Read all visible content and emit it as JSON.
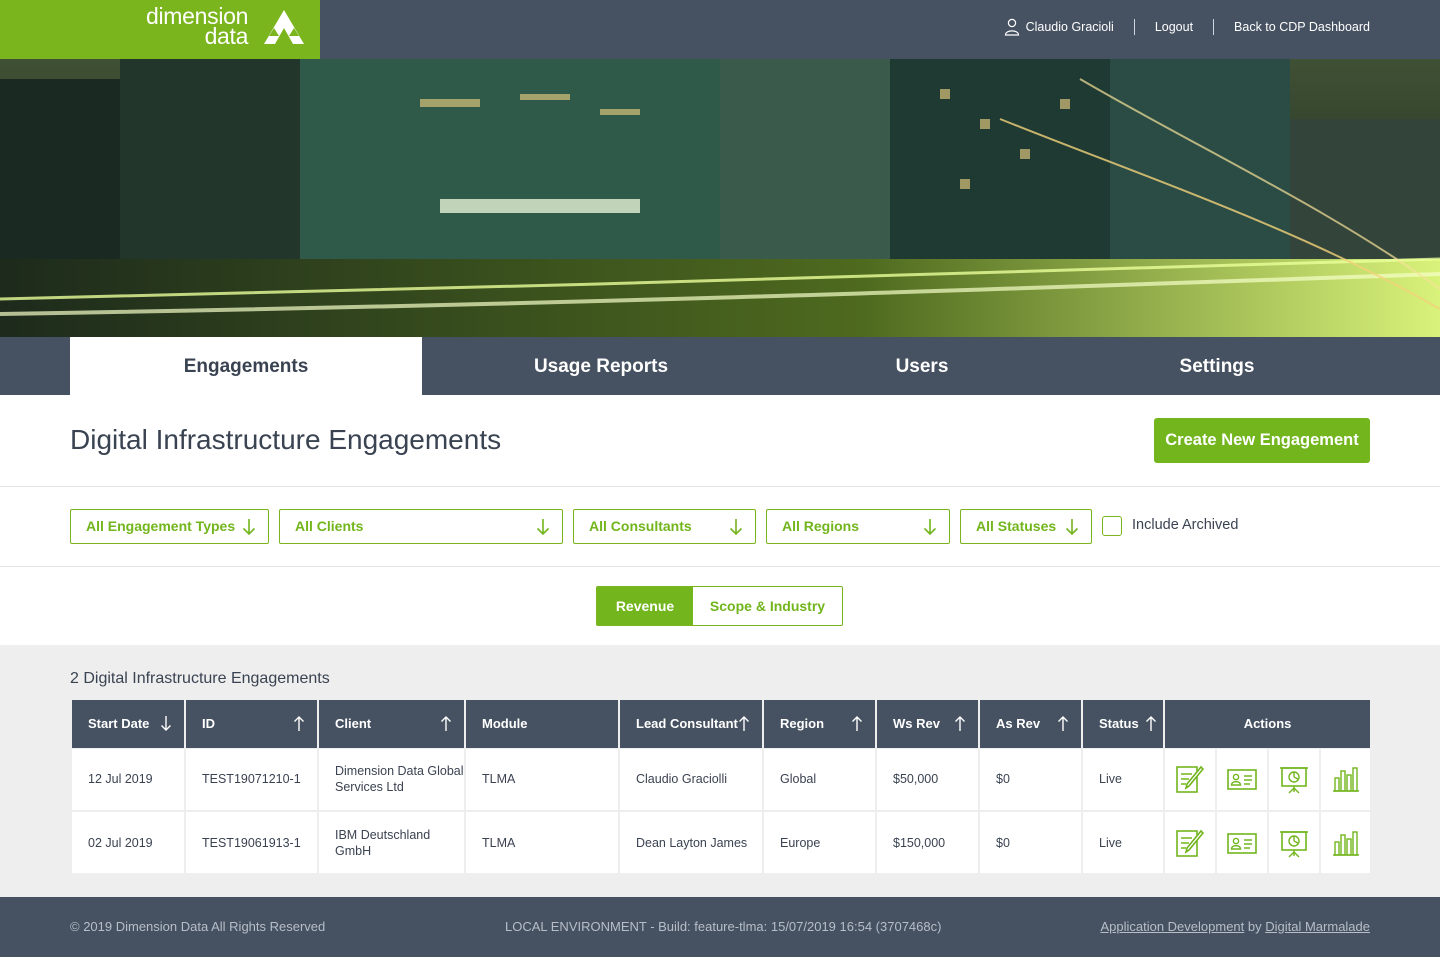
{
  "brand": {
    "line1": "dimension",
    "line2": "data",
    "color": "#7ab51d"
  },
  "header": {
    "user_name": "Claudio Gracioli",
    "logout": "Logout",
    "back_link": "Back to CDP Dashboard"
  },
  "tabs": [
    {
      "label": "Engagements",
      "active": true
    },
    {
      "label": "Usage Reports",
      "active": false
    },
    {
      "label": "Users",
      "active": false
    },
    {
      "label": "Settings",
      "active": false
    }
  ],
  "page": {
    "title": "Digital Infrastructure Engagements",
    "create_button": "Create New Engagement"
  },
  "filters": {
    "engagement_types": "All Engagement Types",
    "clients": "All Clients",
    "consultants": "All Consultants",
    "regions": "All Regions",
    "statuses": "All Statuses",
    "include_archived": "Include Archived"
  },
  "view_toggle": {
    "revenue": "Revenue",
    "scope": "Scope & Industry",
    "selected": "Revenue"
  },
  "results": {
    "count_label": "2 Digital Infrastructure Engagements",
    "columns": {
      "start_date": "Start Date",
      "id": "ID",
      "client": "Client",
      "module": "Module",
      "lead": "Lead Consultant",
      "region": "Region",
      "ws_rev": "Ws Rev",
      "as_rev": "As Rev",
      "status": "Status",
      "actions": "Actions"
    },
    "rows": [
      {
        "start_date": "12 Jul 2019",
        "id": "TEST19071210-1",
        "client": "Dimension Data Global Services Ltd",
        "module": "TLMA",
        "lead": "Claudio Graciolli",
        "region": "Global",
        "ws_rev": "$50,000",
        "as_rev": "$0",
        "status": "Live"
      },
      {
        "start_date": "02 Jul 2019",
        "id": "TEST19061913-1",
        "client": "IBM Deutschland GmbH",
        "module": "TLMA",
        "lead": "Dean Layton James",
        "region": "Europe",
        "ws_rev": "$150,000",
        "as_rev": "$0",
        "status": "Live"
      }
    ]
  },
  "footer": {
    "copyright": "© 2019 Dimension Data All Rights Reserved",
    "build": "LOCAL ENVIRONMENT - Build: feature-tlma: 15/07/2019 16:54 (3707468c)",
    "app_dev_link": "Application Development",
    "by": " by ",
    "company_link": "Digital Marmalade"
  },
  "icons": [
    "user-icon",
    "arrow-down-icon",
    "arrow-up-icon",
    "edit-icon",
    "id-card-icon",
    "presentation-icon",
    "bar-chart-icon"
  ]
}
